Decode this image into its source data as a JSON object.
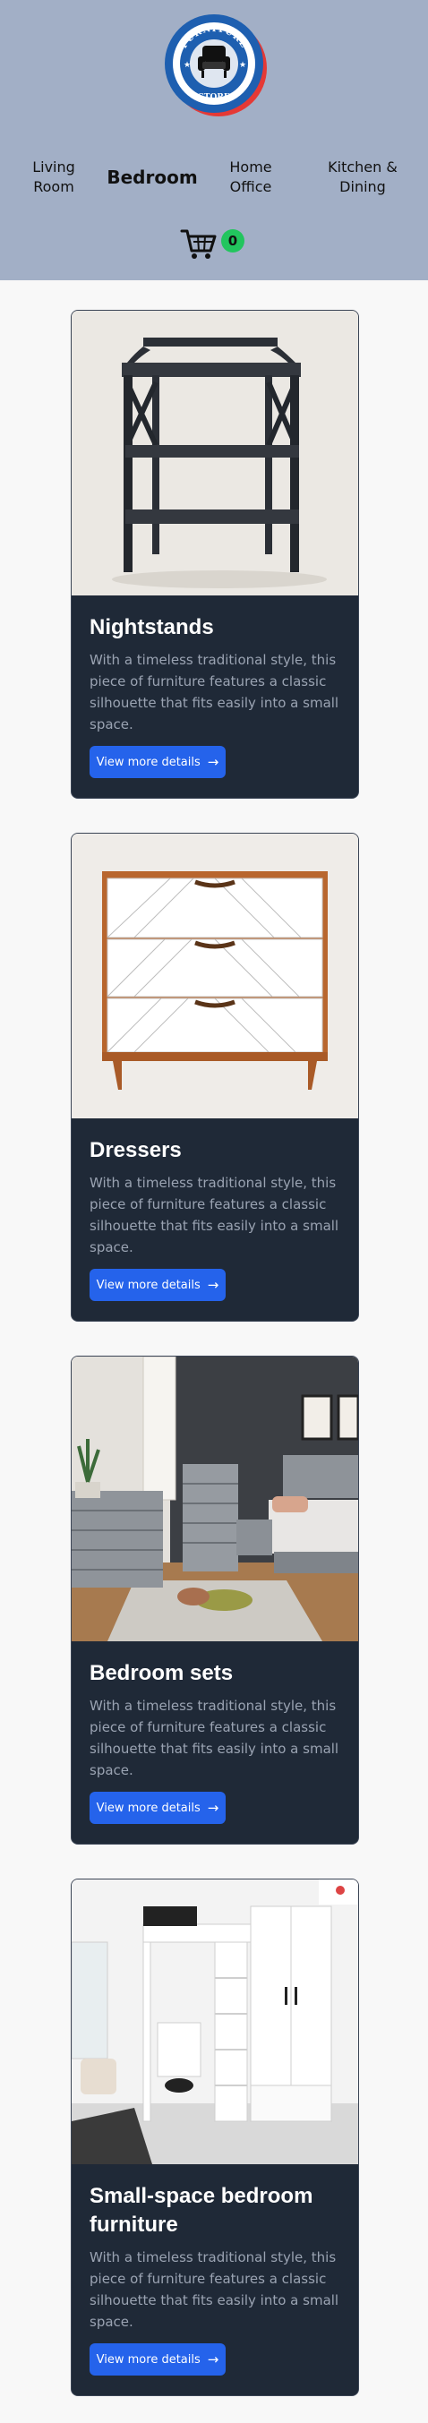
{
  "logo": {
    "top_text": "FURNITURE",
    "bottom_text": "STORE",
    "colors": {
      "ring": "#1e5fb0",
      "accent": "#e53935"
    }
  },
  "nav": {
    "items": [
      {
        "label_line1": "Living",
        "label_line2": "Room"
      },
      {
        "label": "Bedroom",
        "active": true
      },
      {
        "label_line1": "Home",
        "label_line2": "Office"
      },
      {
        "label_line1": "Kitchen &",
        "label_line2": "Dining"
      }
    ]
  },
  "cart": {
    "icon": "cart-icon",
    "count": "0"
  },
  "colors": {
    "header_bg": "#a2afc6",
    "card_bg": "#1f2937",
    "button": "#2563eb",
    "badge": "#22c55e"
  },
  "cards": [
    {
      "title": "Nightstands",
      "description": "With a timeless traditional style, this piece of furniture features a classic silhouette that fits easily into a small space.",
      "button_label": "View more details",
      "button_icon": "arrow-right-icon"
    },
    {
      "title": "Dressers",
      "description": "With a timeless traditional style, this piece of furniture features a classic silhouette that fits easily into a small space.",
      "button_label": "View more details",
      "button_icon": "arrow-right-icon"
    },
    {
      "title": "Bedroom sets",
      "description": "With a timeless traditional style, this piece of furniture features a classic silhouette that fits easily into a small space.",
      "button_label": "View more details",
      "button_icon": "arrow-right-icon"
    },
    {
      "title": "Small-space bedroom furniture",
      "description": "With a timeless traditional style, this piece of furniture features a classic silhouette that fits easily into a small space.",
      "button_label": "View more details",
      "button_icon": "arrow-right-icon"
    }
  ]
}
